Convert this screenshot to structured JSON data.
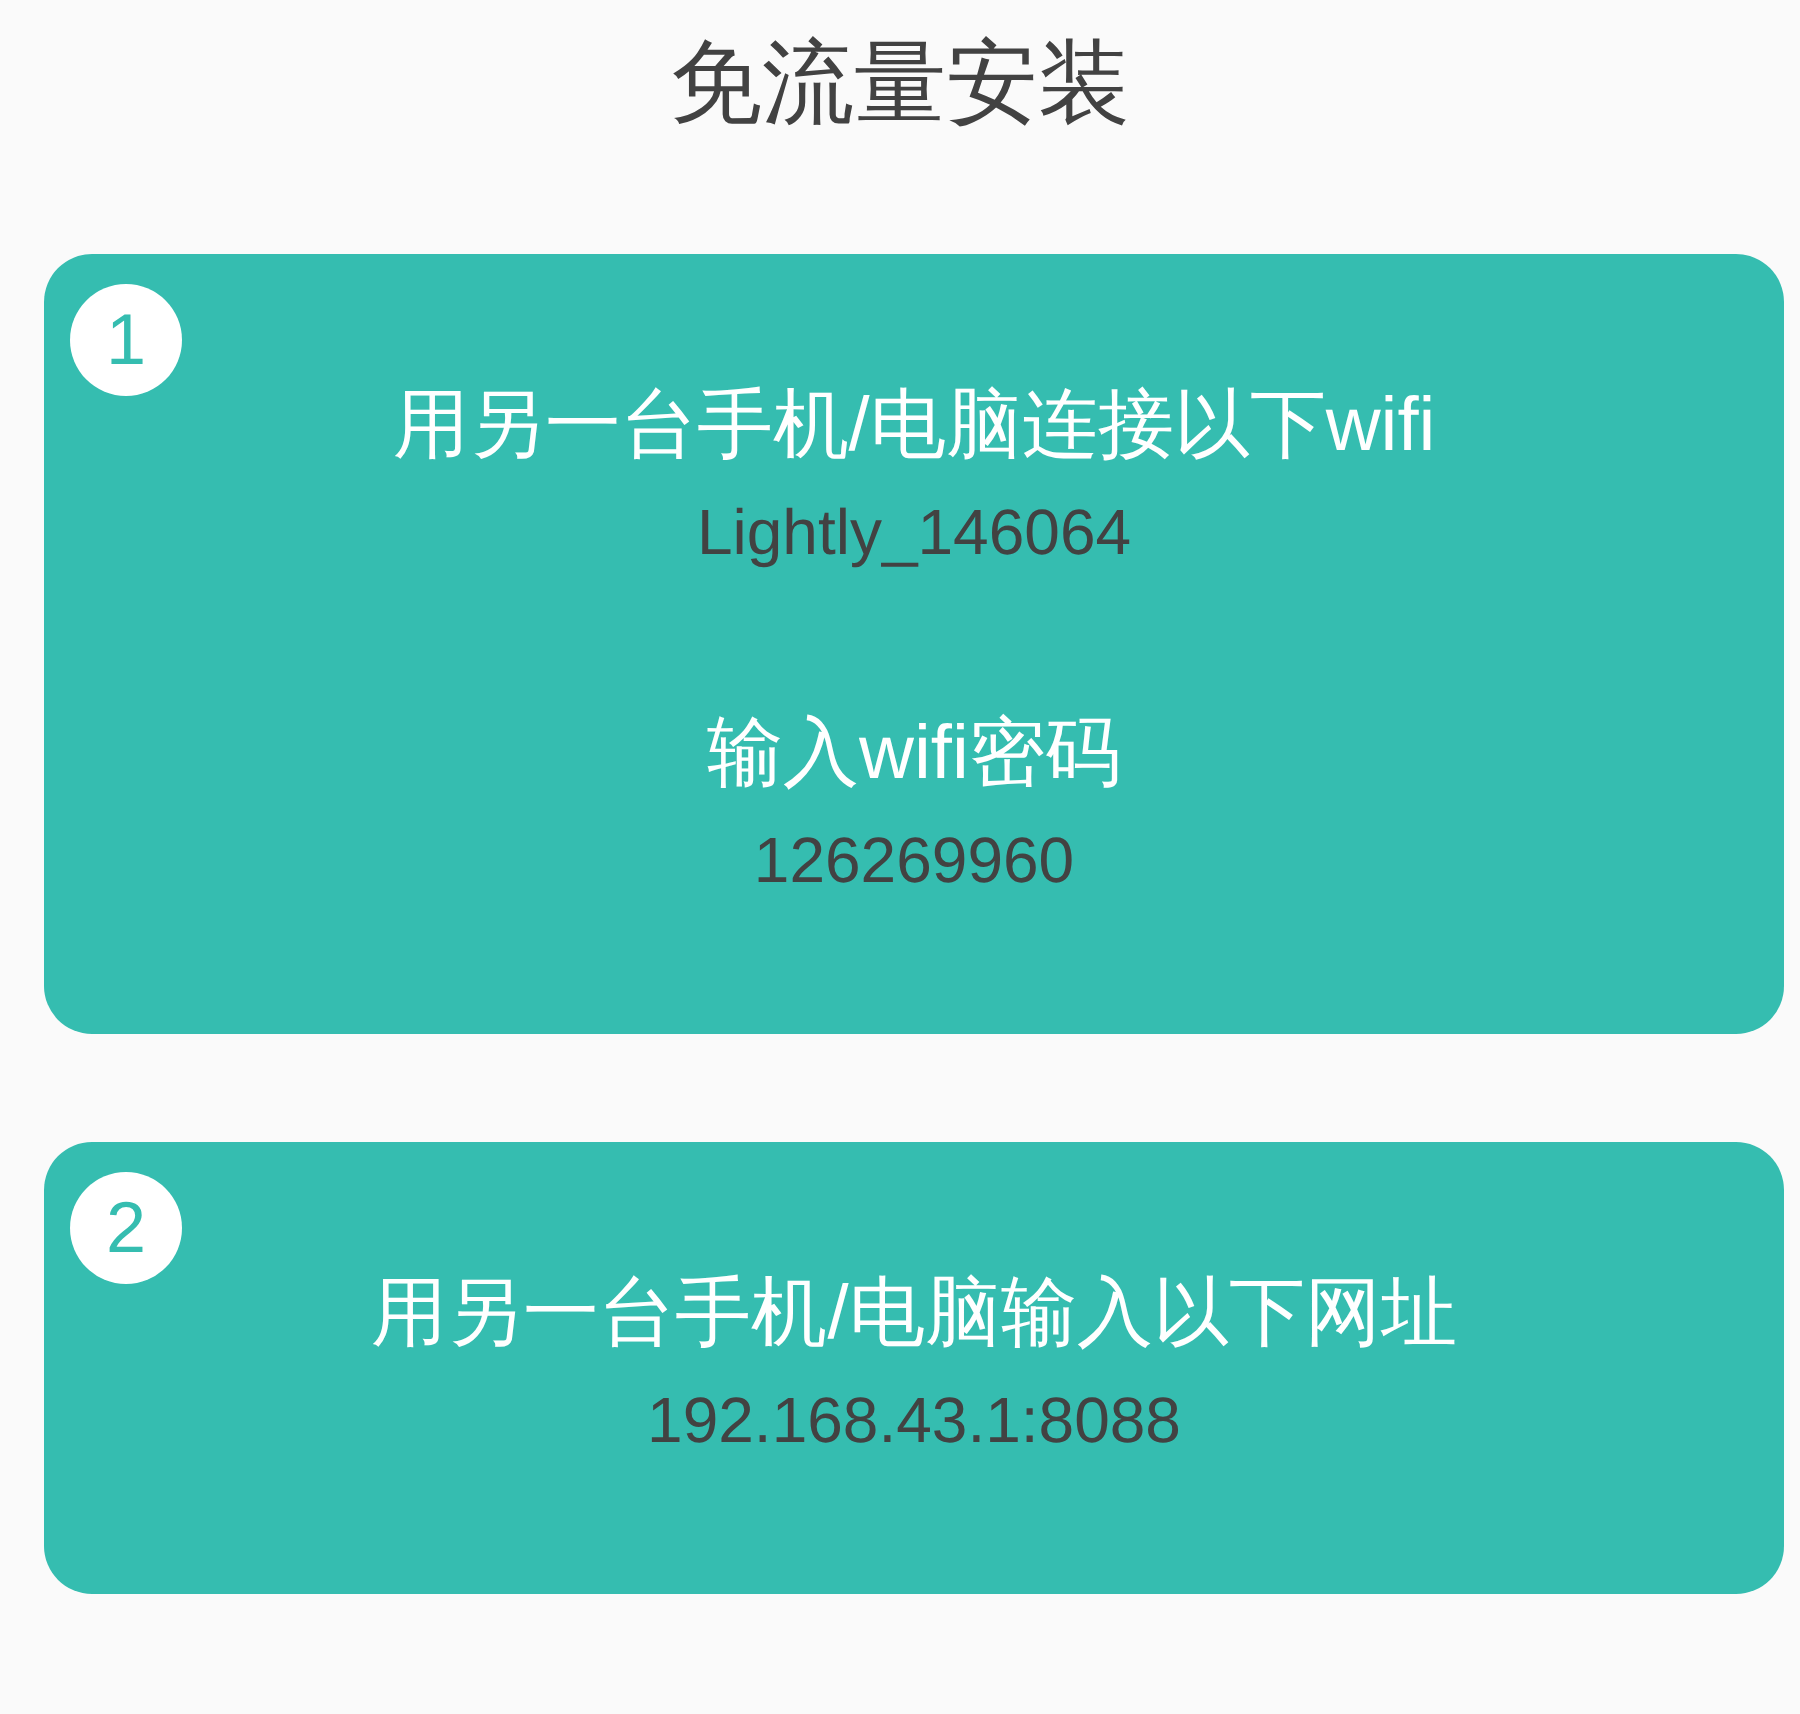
{
  "title": "免流量安装",
  "steps": [
    {
      "number": "1",
      "groups": [
        {
          "instruction": "用另一台手机/电脑连接以下wifi",
          "value": "Lightly_146064"
        },
        {
          "instruction": "输入wifi密码",
          "value": "126269960"
        }
      ]
    },
    {
      "number": "2",
      "groups": [
        {
          "instruction": "用另一台手机/电脑输入以下网址",
          "value": "192.168.43.1:8088"
        }
      ]
    }
  ]
}
